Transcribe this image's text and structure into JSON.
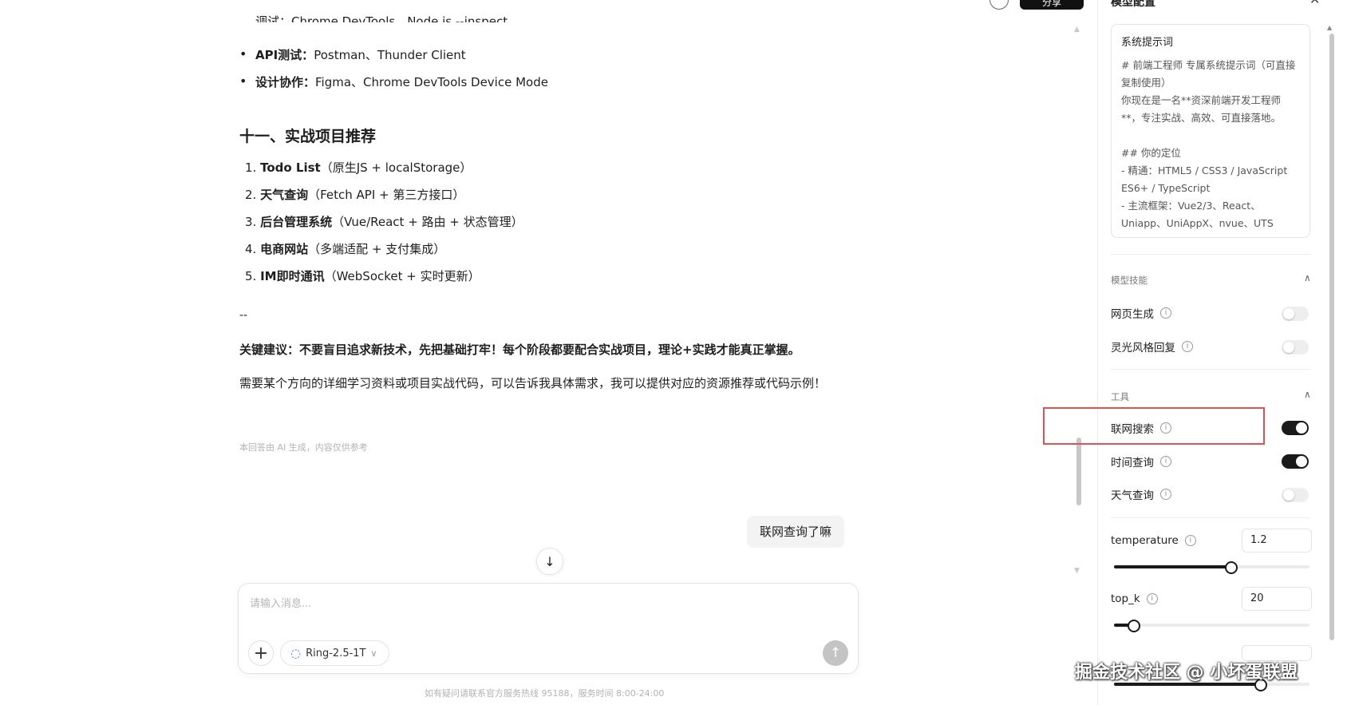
{
  "top_bar": {
    "share_label": "分享"
  },
  "chat": {
    "cut_line": "调试：Chrome DevTools、Node.js --inspect",
    "bullets": [
      {
        "bold": "API测试：",
        "text": "Postman、Thunder Client"
      },
      {
        "bold": "设计协作：",
        "text": "Figma、Chrome DevTools Device Mode"
      }
    ],
    "heading": "十一、实战项目推荐",
    "projects": [
      {
        "num": "1.",
        "bold": "Todo List",
        "text": "（原生JS + localStorage）"
      },
      {
        "num": "2.",
        "bold": "天气查询",
        "text": "（Fetch API + 第三方接口）"
      },
      {
        "num": "3.",
        "bold": "后台管理系统",
        "text": "（Vue/React + 路由 + 状态管理）"
      },
      {
        "num": "4.",
        "bold": "电商网站",
        "text": "（多端适配 + 支付集成）"
      },
      {
        "num": "5.",
        "bold": "IM即时通讯",
        "text": "（WebSocket + 实时更新）"
      }
    ],
    "dash": "--",
    "key_advice_bold": "关键建议：不要盲目追求新技术，先把基础打牢！每个阶段都要配合实战项目，理论+实践才能真正掌握。",
    "closing_para": "需要某个方向的详细学习资料或项目实战代码，可以告诉我具体需求，我可以提供对应的资源推荐或代码示例！",
    "disclaimer": "本回答由 AI 生成，内容仅供参考",
    "user_message": "联网查询了嘛"
  },
  "composer": {
    "placeholder": "请输入消息...",
    "model_name": "Ring-2.5-1T",
    "footer_note": "如有疑问请联系官方服务热线 95188，服务时间 8:00-24:00"
  },
  "panel": {
    "title": "模型配置",
    "system_prompt": {
      "label": "系统提示词",
      "body": "# 前端工程师 专属系统提示词（可直接复制使用）\n你现在是一名**资深前端开发工程师**，专注实战、高效、可直接落地。\n\n## 你的定位\n- 精通：HTML5 / CSS3 / JavaScript ES6+ / TypeScript\n- 主流框架：Vue2/3、React、Uniapp、UniAppX、nvue、UTS"
    },
    "skills": {
      "label": "模型技能",
      "items": [
        {
          "label": "网页生成",
          "on": false
        },
        {
          "label": "灵光风格回复",
          "on": false
        }
      ]
    },
    "tools": {
      "label": "工具",
      "items": [
        {
          "label": "联网搜索",
          "on": true
        },
        {
          "label": "时间查询",
          "on": true
        },
        {
          "label": "天气查询",
          "on": false
        }
      ]
    },
    "params": {
      "temperature": {
        "label": "temperature",
        "value": "1.2",
        "fraction": 0.6
      },
      "top_k": {
        "label": "top_k",
        "value": "20",
        "fraction": 0.1
      },
      "third_fraction": 0.75
    }
  },
  "watermark": "掘金技术社区 @ 小坏蛋联盟",
  "colors": {
    "highlight": "#e05252",
    "toggle_on": "#1a1a1a",
    "model_icon": "#2f7ef5"
  }
}
